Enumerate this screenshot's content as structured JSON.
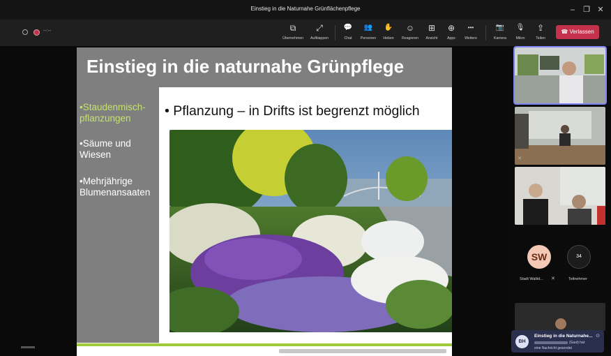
{
  "window": {
    "title": "Einstieg in die Naturnahe Grünflächenpflege",
    "controls": {
      "minimize": "–",
      "maximize": "❐",
      "close": "✕"
    }
  },
  "recording": {
    "timer": "--:--"
  },
  "toolbar": {
    "buttons": [
      {
        "label": "Übernehmen",
        "icon": "⧉"
      },
      {
        "label": "Aufklappen",
        "icon": "⤢"
      },
      {
        "label": "Chat",
        "icon": "💬"
      },
      {
        "label": "Personen",
        "icon": "👥"
      },
      {
        "label": "Heben",
        "icon": "✋"
      },
      {
        "label": "Reagieren",
        "icon": "☺"
      },
      {
        "label": "Ansicht",
        "icon": "⊞"
      },
      {
        "label": "Apps",
        "icon": "⊕"
      },
      {
        "label": "Weitere",
        "icon": "•••"
      },
      {
        "label": "Kamera",
        "icon": "📷"
      },
      {
        "label": "Mikro",
        "icon": "🎙"
      },
      {
        "label": "Teilen",
        "icon": "⇪"
      }
    ],
    "leave_label": "Verlassen"
  },
  "slide": {
    "title": "Einstieg in die naturnahe Grünpflege",
    "nav": [
      {
        "label": "•Staudenmisch-\npflanzungen",
        "active": true
      },
      {
        "label": "•Säume und\nWiesen",
        "active": false
      },
      {
        "label": "•Mehrjährige\nBlumenansaaten",
        "active": false
      }
    ],
    "bullet": "• Pflanzung – in Drifts ist begrenzt möglich"
  },
  "participants": {
    "avatar_initials": "SW",
    "avatar_name": "Stadt Wallid...",
    "count": "34",
    "count_label": "Teilnehmer"
  },
  "notification": {
    "initials": "BH",
    "title": "Einstieg in die Naturnahe...",
    "line2_suffix": "(Gast) hat",
    "line3": "eine Nachricht gesendet"
  },
  "colors": {
    "accent": "#7f85f5",
    "leave": "#c4314b",
    "slide_gray": "#7f7f7f",
    "active_nav": "#c6e36a",
    "footer_green": "#9ecb3a"
  }
}
